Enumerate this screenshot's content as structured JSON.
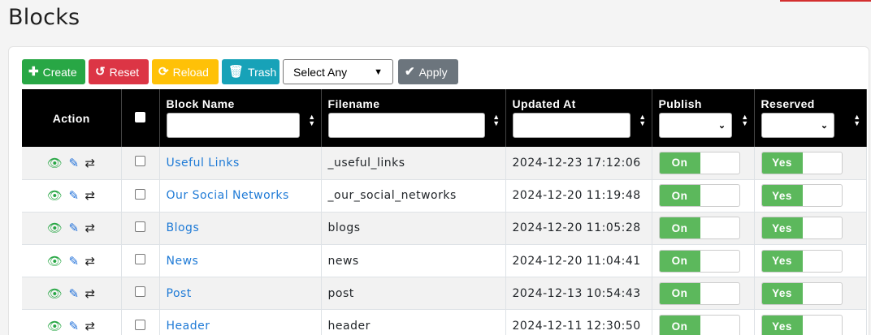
{
  "page_title": "Blocks",
  "toolbar": {
    "create_label": "Create",
    "reset_label": "Reset",
    "reload_label": "Reload",
    "trash_label": "Trash",
    "select_value": "Select Any",
    "apply_label": "Apply"
  },
  "columns": {
    "action": "Action",
    "block_name": "Block Name",
    "filename": "Filename",
    "updated_at": "Updated At",
    "publish": "Publish",
    "reserved": "Reserved"
  },
  "rows": [
    {
      "name": "Useful Links",
      "filename": "_useful_links",
      "updated": "2024-12-23 17:12:06",
      "publish": "On",
      "reserved": "Yes"
    },
    {
      "name": "Our Social Networks",
      "filename": "_our_social_networks",
      "updated": "2024-12-20 11:19:48",
      "publish": "On",
      "reserved": "Yes"
    },
    {
      "name": "Blogs",
      "filename": "blogs",
      "updated": "2024-12-20 11:05:28",
      "publish": "On",
      "reserved": "Yes"
    },
    {
      "name": "News",
      "filename": "news",
      "updated": "2024-12-20 11:04:41",
      "publish": "On",
      "reserved": "Yes"
    },
    {
      "name": "Post",
      "filename": "post",
      "updated": "2024-12-13 10:54:43",
      "publish": "On",
      "reserved": "Yes"
    },
    {
      "name": "Header",
      "filename": "header",
      "updated": "2024-12-11 12:30:50",
      "publish": "On",
      "reserved": "Yes"
    }
  ],
  "colors": {
    "create": "#28a745",
    "reset": "#dc3545",
    "reload": "#ffc107",
    "trash": "#17a2b8",
    "apply": "#6c757d",
    "toggle_on": "#5cb85c",
    "link": "#1e7ad6"
  }
}
